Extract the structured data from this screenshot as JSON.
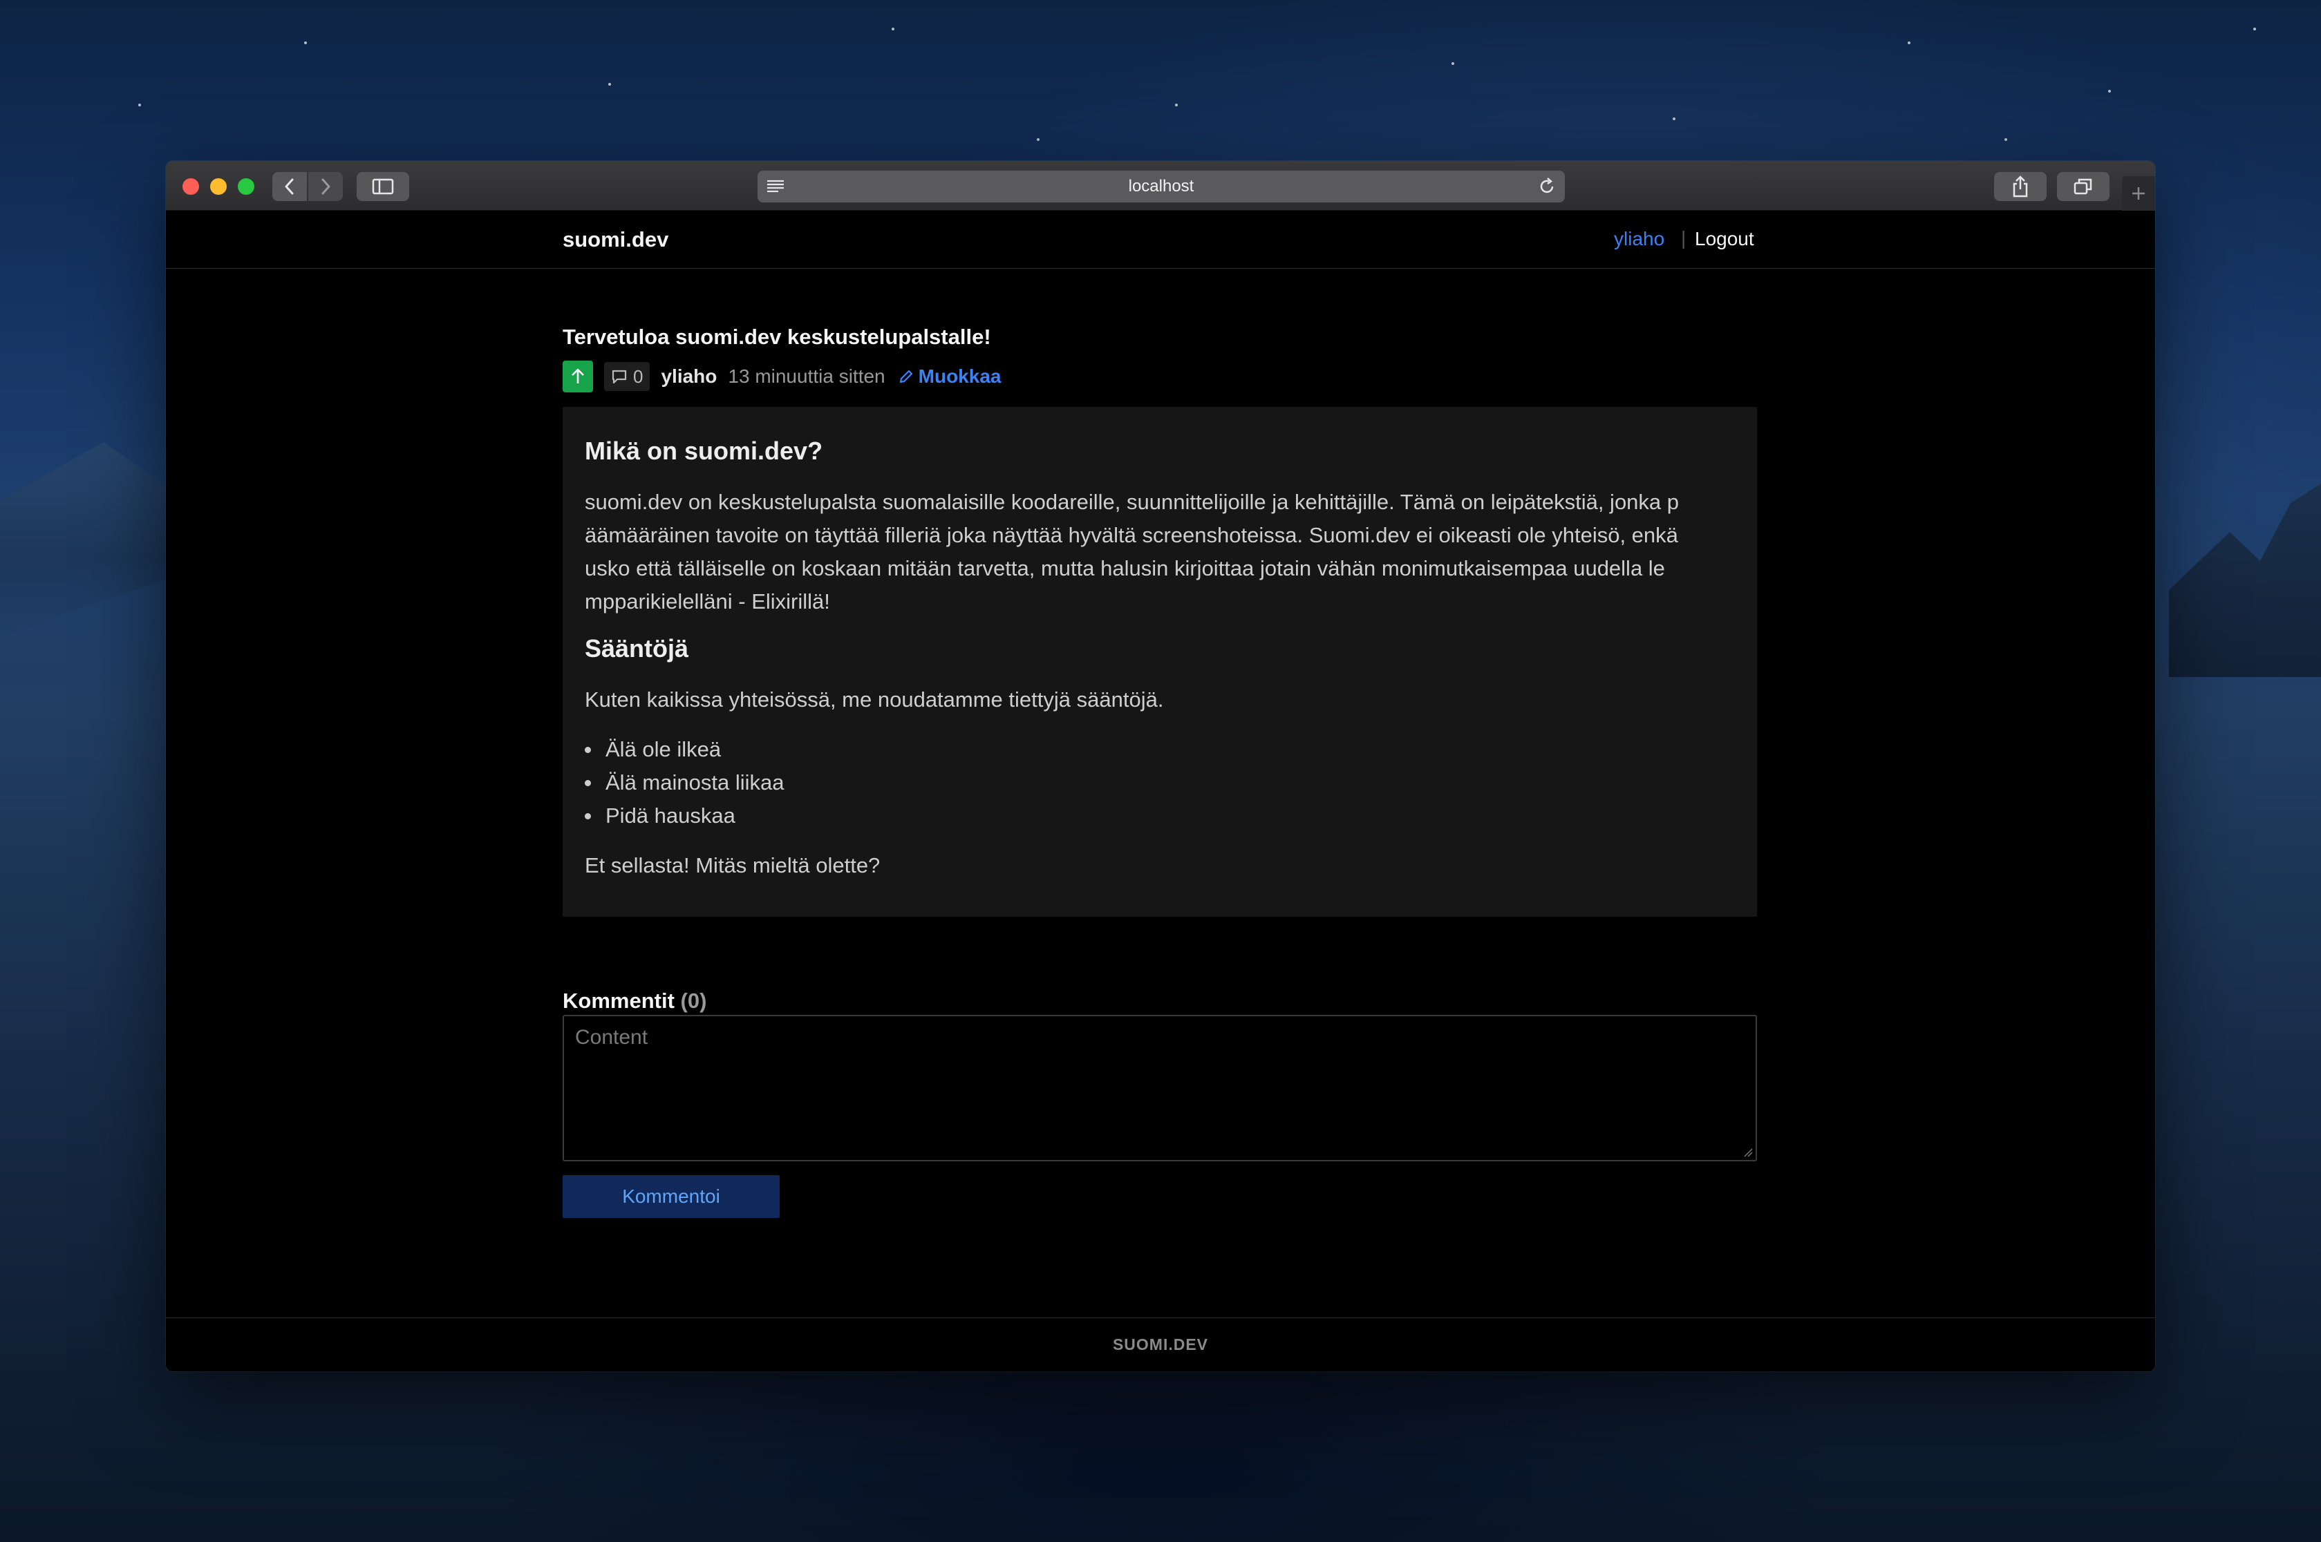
{
  "browser": {
    "url": "localhost",
    "icons": {
      "back": "chevron-left-icon",
      "forward": "chevron-right-icon",
      "sidebar": "sidebar-icon",
      "reader": "reader-icon",
      "reload": "reload-icon",
      "share": "share-icon",
      "tabs": "tabs-overview-icon",
      "new_tab": "plus-icon"
    }
  },
  "header": {
    "brand": "suomi.dev",
    "user": "yliaho",
    "separator": "|",
    "logout": "Logout"
  },
  "post": {
    "title": "Tervetuloa suomi.dev keskustelupalstalle!",
    "comment_count": "0",
    "author": "yliaho",
    "time": "13 minuuttia sitten",
    "edit_label": "Muokkaa",
    "body": {
      "heading1": "Mikä on suomi.dev?",
      "lines1": [
        "suomi.dev on keskustelupalsta suomalaisille koodareille, suunnittelijoille ja kehittäjille. Tämä on leipätekstiä, jonka p",
        "äämääräinen tavoite on täyttää filleriä joka näyttää hyvältä screenshoteissa. Suomi.dev ei oikeasti ole yhteisö, enkä",
        "usko että tälläiselle on koskaan mitään tarvetta, mutta halusin kirjoittaa jotain vähän monimutkaisempaa uudella le",
        "mpparikielelläni - Elixirillä!"
      ],
      "heading2": "Sääntöjä",
      "paragraph2": "Kuten kaikissa yhteisössä, me noudatamme tiettyjä sääntöjä.",
      "rules": [
        "Älä ole ilkeä",
        "Älä mainosta liikaa",
        "Pidä hauskaa"
      ],
      "closing": "Et sellasta! Mitäs mieltä olette?"
    }
  },
  "comments": {
    "title": "Kommentit",
    "count": "(0)",
    "input_value": "",
    "placeholder": "Content",
    "submit_label": "Kommentoi"
  },
  "footer": {
    "text": "SUOMI.DEV"
  },
  "colors": {
    "accent": "#3b82f6",
    "upvote": "#16a34a",
    "button_bg": "#10295a",
    "page_bg": "#000000",
    "card_bg": "#161616"
  }
}
